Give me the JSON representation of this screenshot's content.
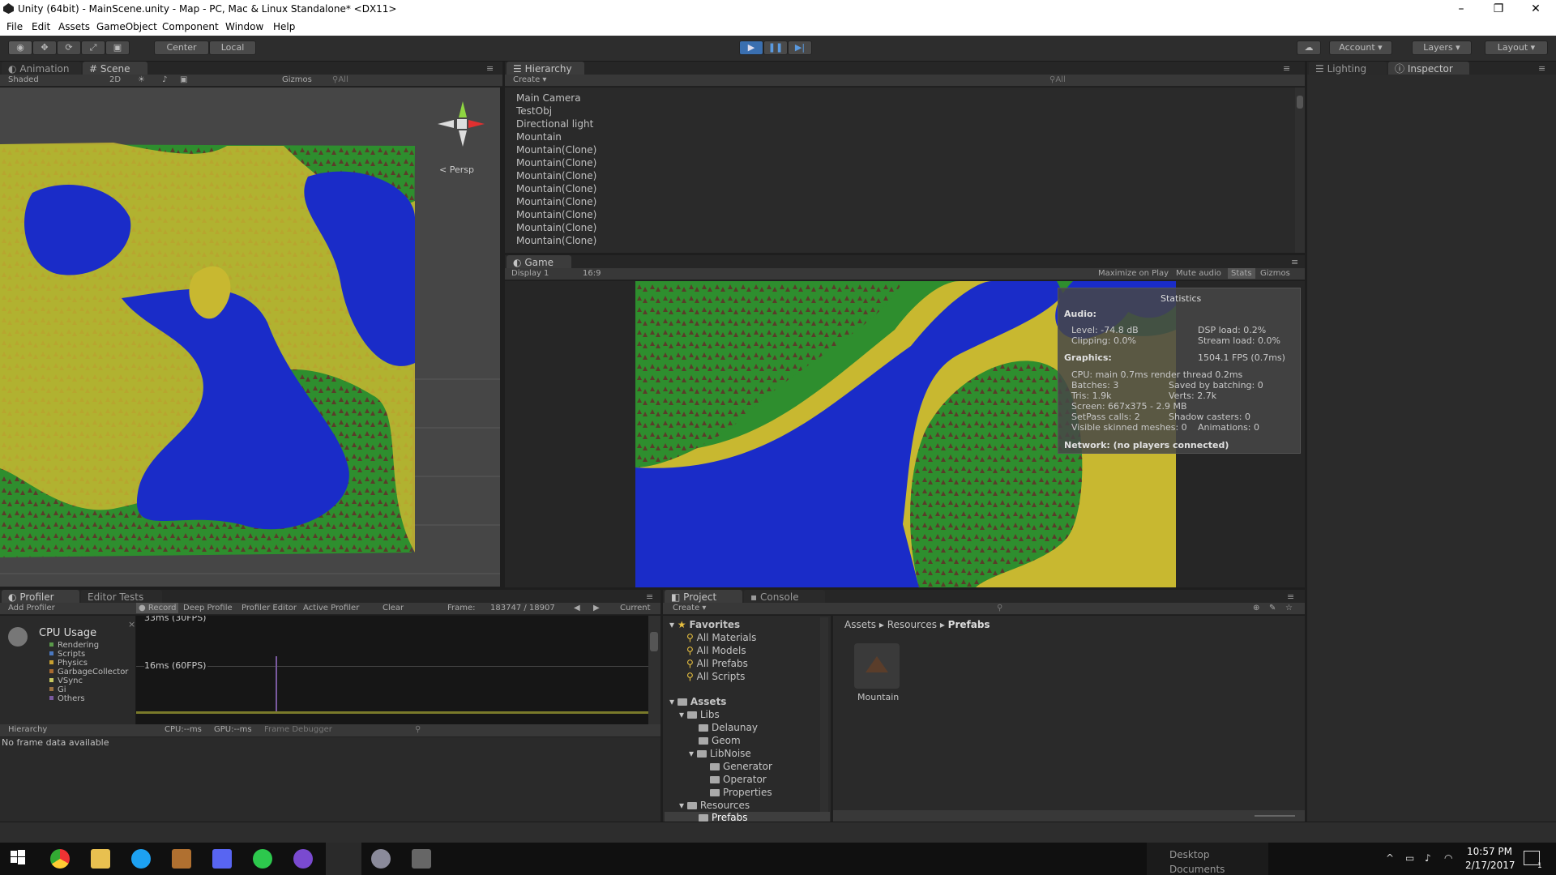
{
  "window": {
    "title": "Unity (64bit) - MainScene.unity - Map - PC, Mac & Linux Standalone* <DX11>",
    "minimize": "–",
    "maximize": "❐",
    "close": "✕"
  },
  "menu": [
    "File",
    "Edit",
    "Assets",
    "GameObject",
    "Component",
    "Window",
    "Help"
  ],
  "toolbar": {
    "pivot": "Center",
    "space": "Local",
    "cloud_icon": "cloud-icon",
    "account": "Account",
    "layers": "Layers",
    "layout": "Layout"
  },
  "scene_panel": {
    "tabs": [
      "Animation",
      "Scene"
    ],
    "shading": "Shaded",
    "mode_2d": "2D",
    "gizmos": "Gizmos",
    "search_placeholder": "All",
    "persp": "Persp"
  },
  "hierarchy": {
    "tab": "Hierarchy",
    "create": "Create",
    "search_placeholder": "All",
    "items": [
      "Main Camera",
      "TestObj",
      "Directional light",
      "Mountain",
      "Mountain(Clone)",
      "Mountain(Clone)",
      "Mountain(Clone)",
      "Mountain(Clone)",
      "Mountain(Clone)",
      "Mountain(Clone)",
      "Mountain(Clone)",
      "Mountain(Clone)"
    ]
  },
  "right_tabs": [
    "Lighting",
    "Inspector"
  ],
  "game_panel": {
    "tab": "Game",
    "display": "Display 1",
    "aspect": "16:9",
    "maximize": "Maximize on Play",
    "mute": "Mute audio",
    "stats": "Stats",
    "gizmos": "Gizmos"
  },
  "statistics": {
    "title": "Statistics",
    "audio_header": "Audio:",
    "level": "Level: -74.8 dB",
    "clipping": "Clipping: 0.0%",
    "dsp": "DSP load: 0.2%",
    "stream": "Stream load: 0.0%",
    "graphics_header": "Graphics:",
    "fps": "1504.1 FPS (0.7ms)",
    "cpu": "CPU: main 0.7ms  render thread 0.2ms",
    "batches": "Batches: 3",
    "saved": "Saved by batching: 0",
    "tris": "Tris: 1.9k",
    "verts": "Verts: 2.7k",
    "screen": "Screen: 667x375 - 2.9 MB",
    "setpass": "SetPass calls: 2",
    "shadow": "Shadow casters: 0",
    "skinned": "Visible skinned meshes: 0",
    "animations": "Animations: 0",
    "network": "Network: (no players connected)"
  },
  "profiler": {
    "tabs": [
      "Profiler",
      "Editor Tests"
    ],
    "add": "Add Profiler",
    "record": "Record",
    "deep": "Deep Profile",
    "editor": "Profiler Editor",
    "active": "Active Profiler",
    "clear": "Clear",
    "frame_label": "Frame:",
    "frame_value": "183747 / 18907",
    "current": "Current",
    "cpu_title": "CPU Usage",
    "legend": [
      {
        "name": "Rendering",
        "color": "#5a9a4a"
      },
      {
        "name": "Scripts",
        "color": "#4a78c0"
      },
      {
        "name": "Physics",
        "color": "#c8a030"
      },
      {
        "name": "GarbageCollector",
        "color": "#a86a30"
      },
      {
        "name": "VSync",
        "color": "#c8c860"
      },
      {
        "name": "Gi",
        "color": "#9a7040"
      },
      {
        "name": "Others",
        "color": "#7a5aa0"
      }
    ],
    "line_30": "33ms (30FPS)",
    "line_60": "16ms (60FPS)",
    "hierarchy": "Hierarchy",
    "cpu_ms": "CPU:--ms",
    "gpu_ms": "GPU:--ms",
    "frame_debugger": "Frame Debugger",
    "no_data": "No frame data available"
  },
  "project": {
    "tabs": [
      "Project",
      "Console"
    ],
    "create": "Create",
    "favorites": "Favorites",
    "fav_items": [
      "All Materials",
      "All Models",
      "All Prefabs",
      "All Scripts"
    ],
    "assets": "Assets",
    "libs": "Libs",
    "delaunay": "Delaunay",
    "geom": "Geom",
    "libnoise": "LibNoise",
    "generator": "Generator",
    "operator": "Operator",
    "properties": "Properties",
    "resources": "Resources",
    "prefabs": "Prefabs",
    "breadcrumb": [
      "Assets",
      "Resources",
      "Prefabs"
    ],
    "asset_name": "Mountain"
  },
  "taskbar": {
    "desktop": "Desktop",
    "documents": "Documents",
    "time": "10:57 PM",
    "date": "2/17/2017",
    "notification_count": "1"
  }
}
